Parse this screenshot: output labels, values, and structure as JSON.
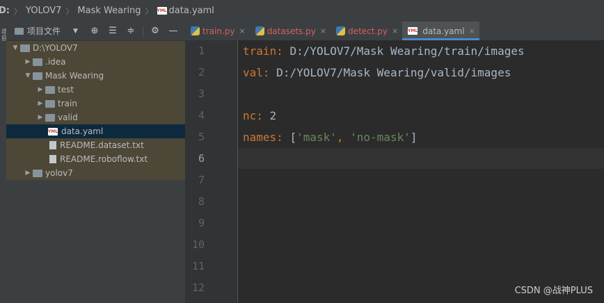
{
  "breadcrumb": {
    "items": [
      "D:",
      "YOLOV7",
      "Mask Wearing",
      "data.yaml"
    ],
    "yaml_icon_text": "YML"
  },
  "sidestrip": {
    "label": "项目"
  },
  "project": {
    "title": "项目文件",
    "dropdown_icon": "chevron-down-icon",
    "toolbar_icons": [
      "locate-icon",
      "expand-all-icon",
      "collapse-all-icon",
      "gear-icon",
      "minimize-icon"
    ],
    "tree": [
      {
        "label": "D:\\YOLOV7",
        "expanded": true
      },
      {
        "label": ".idea",
        "expanded": false
      },
      {
        "label": "Mask Wearing",
        "expanded": true
      },
      {
        "label": "test",
        "expanded": false
      },
      {
        "label": "train",
        "expanded": false
      },
      {
        "label": "valid",
        "expanded": false
      },
      {
        "label": "data.yaml",
        "selected": true
      },
      {
        "label": "README.dataset.txt"
      },
      {
        "label": "README.roboflow.txt"
      },
      {
        "label": "yolov7",
        "expanded": false
      }
    ]
  },
  "tabs": [
    {
      "label": "train.py",
      "active": false
    },
    {
      "label": "datasets.py",
      "active": false
    },
    {
      "label": "detect.py",
      "active": false
    },
    {
      "label": "data.yaml",
      "active": true
    }
  ],
  "tab_close_glyph": "×",
  "editor": {
    "line_numbers": [
      "1",
      "2",
      "3",
      "4",
      "5",
      "6",
      "7",
      "8",
      "9",
      "10",
      "11",
      "12"
    ],
    "current_line": "6",
    "code": {
      "l1_key": "train",
      "l1_colon": ":",
      "l1_value": " D:/YOLOV7/Mask Wearing/train/images",
      "l2_key": "val",
      "l2_colon": ":",
      "l2_value": " D:/YOLOV7/Mask Wearing/valid/images",
      "l4_key": "nc",
      "l4_colon": ":",
      "l4_value": " 2",
      "l5_key": "names",
      "l5_colon": ":",
      "l5_open": " [",
      "l5_s1": "'mask'",
      "l5_comma": ", ",
      "l5_s2": "'no-mask'",
      "l5_close": "]"
    }
  },
  "watermark": "CSDN @战神PLUS",
  "colors": {
    "key": "#cc7832",
    "string": "#6a8759",
    "text": "#a9b7c6",
    "py_tab": "#d36060",
    "active_tab_underline": "#4a88c7",
    "selection": "#0d293e"
  }
}
